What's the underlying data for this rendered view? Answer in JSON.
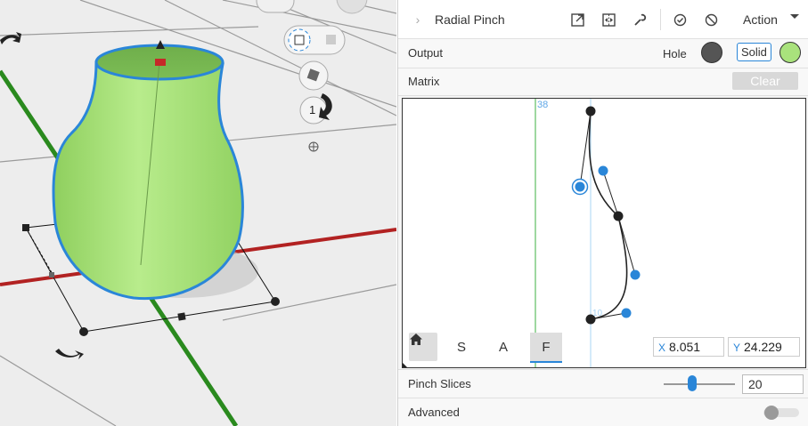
{
  "viewport": {
    "view_cube_number": "1",
    "shape_color": "#a9e27c",
    "shape_outline": "#2a86d8"
  },
  "panel": {
    "title": "Radial Pinch",
    "action_label": "Action",
    "output": {
      "label": "Output",
      "hole_label": "Hole",
      "solid_label": "Solid",
      "hole_color": "#555555",
      "solid_color": "#a9e27c"
    },
    "matrix": {
      "label": "Matrix",
      "clear_label": "Clear"
    },
    "editor": {
      "axis_top_label": "38",
      "axis_bottom_label": "10",
      "modes": [
        "S",
        "A",
        "F"
      ],
      "active_mode": "F",
      "x_label": "X",
      "x_value": "8.051",
      "y_label": "Y",
      "y_value": "24.229",
      "accent_color": "#2a86d8",
      "axis_color": "#3cb043"
    },
    "pinch_slices": {
      "label": "Pinch Slices",
      "value": "20",
      "slider_fraction": 0.4
    },
    "advanced": {
      "label": "Advanced",
      "enabled": false
    }
  }
}
